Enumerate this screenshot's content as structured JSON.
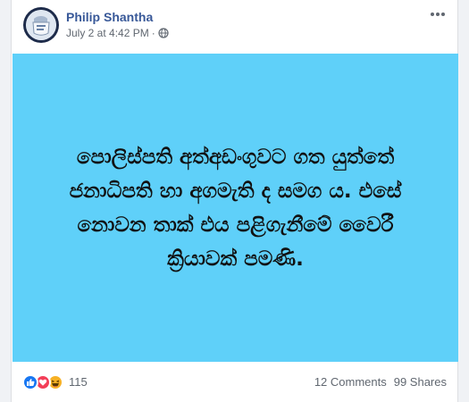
{
  "post": {
    "author": "Philip Shantha",
    "date": "July 2 at 4:42 PM",
    "separator": "·",
    "privacy_icon": "globe-icon",
    "text_lines": [
      "පොලිස්පති අත්අඩංගුවට ගත යුත්තේ",
      "ජනාධිපති හා අගමැති ද සමග ය. එසේ",
      "නොවන තාක් එය පළිගැනීමේ වෛරී",
      "ක්‍රියාවක් පමණි."
    ],
    "background_color": "#5fd0f9"
  },
  "footer": {
    "reaction_icons": [
      "like-icon",
      "love-icon",
      "haha-icon"
    ],
    "reaction_count": "115",
    "comments": "12 Comments",
    "shares": "99 Shares"
  }
}
